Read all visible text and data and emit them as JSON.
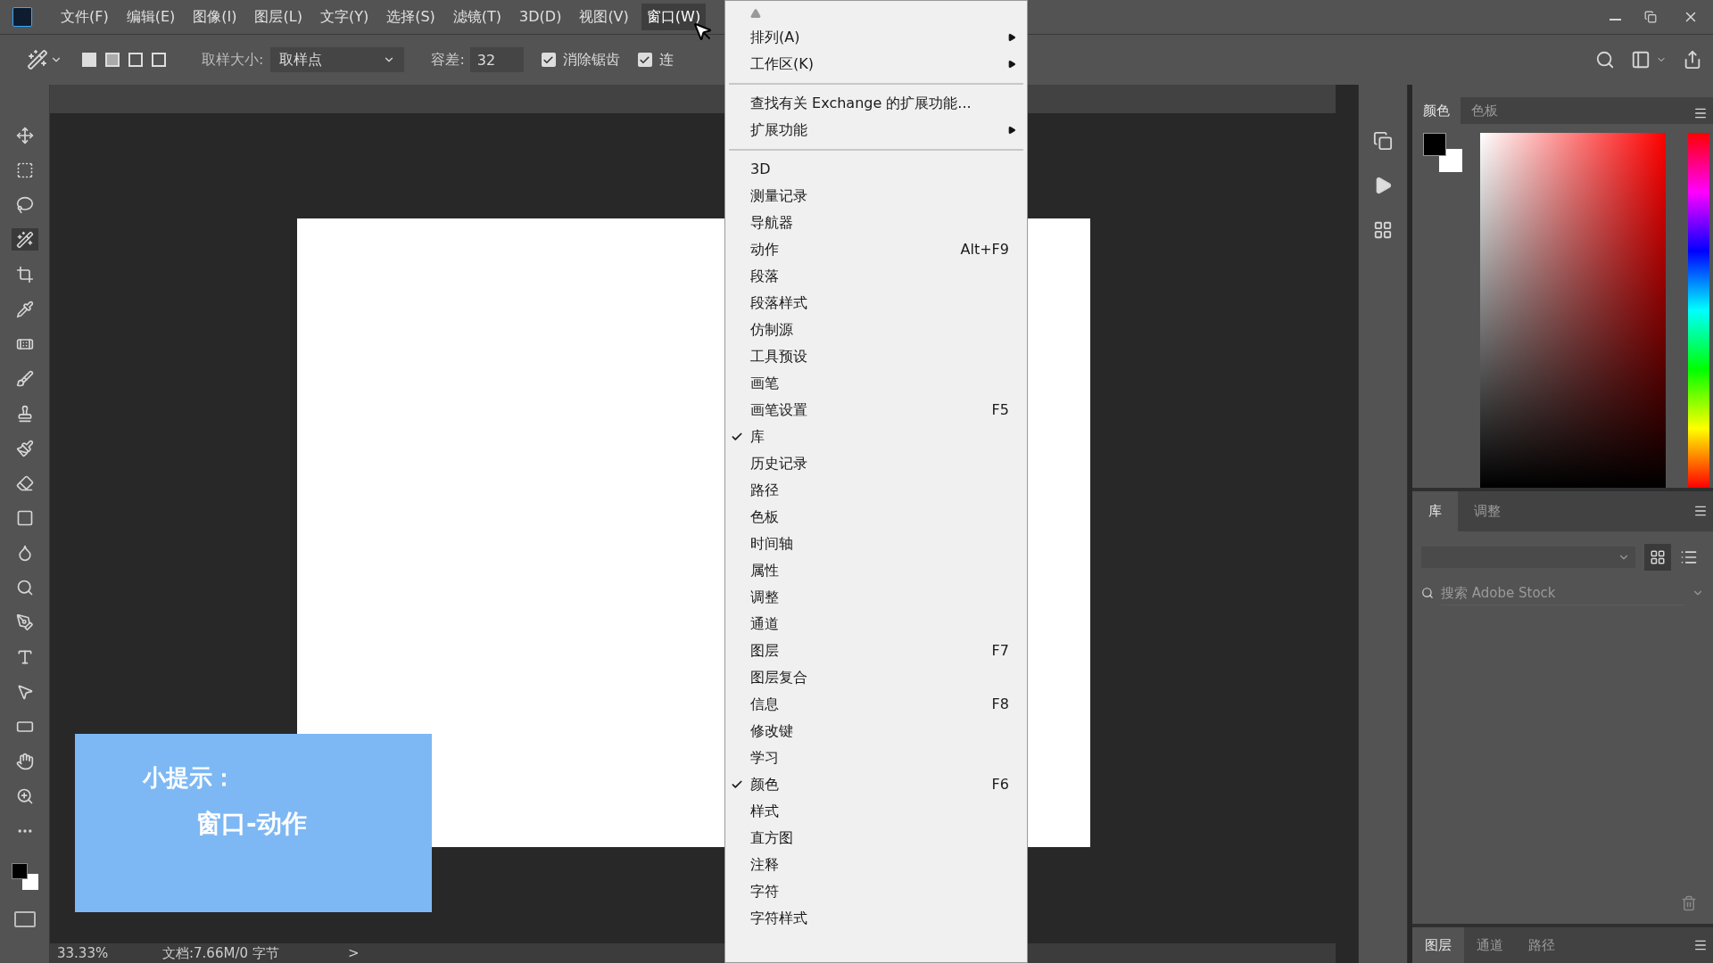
{
  "menu_bar": {
    "items": [
      {
        "label": "文件(F)",
        "selected": false
      },
      {
        "label": "编辑(E)",
        "selected": false
      },
      {
        "label": "图像(I)",
        "selected": false
      },
      {
        "label": "图层(L)",
        "selected": false
      },
      {
        "label": "文字(Y)",
        "selected": false
      },
      {
        "label": "选择(S)",
        "selected": false
      },
      {
        "label": "滤镜(T)",
        "selected": false
      },
      {
        "label": "3D(D)",
        "selected": false
      },
      {
        "label": "视图(V)",
        "selected": false
      },
      {
        "label": "窗口(W)",
        "selected": true
      }
    ]
  },
  "options_bar": {
    "sample_size_label": "取样大小:",
    "sample_size_value": "取样点",
    "tolerance_label": "容差:",
    "tolerance_value": "32",
    "checkboxes": [
      {
        "label": "消除锯齿",
        "checked": true
      },
      {
        "label": "连",
        "checked": true
      }
    ]
  },
  "tools": [
    {
      "selected": false
    },
    {
      "selected": false
    },
    {
      "selected": false
    },
    {
      "selected": true
    },
    {
      "selected": false
    },
    {
      "selected": false
    },
    {
      "selected": false
    },
    {
      "selected": false
    },
    {
      "selected": false
    },
    {
      "selected": false
    },
    {
      "selected": false
    },
    {
      "selected": false
    },
    {
      "selected": false
    },
    {
      "selected": false
    },
    {
      "selected": false
    },
    {
      "selected": false
    },
    {
      "selected": false
    },
    {
      "selected": false
    },
    {
      "selected": false
    },
    {
      "selected": false
    },
    {
      "selected": false
    }
  ],
  "tip": {
    "title": "小提示：",
    "body": "窗口-动作"
  },
  "window_menu": {
    "sections": [
      [
        {
          "label": "排列(A)",
          "submenu": true,
          "checked": false
        },
        {
          "label": "工作区(K)",
          "submenu": true,
          "checked": false
        }
      ],
      [
        {
          "label": "查找有关 Exchange 的扩展功能...",
          "submenu": false,
          "checked": false
        },
        {
          "label": "扩展功能",
          "submenu": true,
          "checked": false
        }
      ],
      [
        {
          "label": "3D",
          "submenu": false,
          "checked": false
        },
        {
          "label": "测量记录",
          "submenu": false,
          "checked": false
        },
        {
          "label": "导航器",
          "submenu": false,
          "checked": false
        },
        {
          "label": "动作",
          "shortcut": "Alt+F9",
          "submenu": false,
          "checked": false
        },
        {
          "label": "段落",
          "submenu": false,
          "checked": false
        },
        {
          "label": "段落样式",
          "submenu": false,
          "checked": false
        },
        {
          "label": "仿制源",
          "submenu": false,
          "checked": false
        },
        {
          "label": "工具预设",
          "submenu": false,
          "checked": false
        },
        {
          "label": "画笔",
          "submenu": false,
          "checked": false
        },
        {
          "label": "画笔设置",
          "shortcut": "F5",
          "submenu": false,
          "checked": false
        },
        {
          "label": "库",
          "submenu": false,
          "checked": true
        },
        {
          "label": "历史记录",
          "submenu": false,
          "checked": false
        },
        {
          "label": "路径",
          "submenu": false,
          "checked": false
        },
        {
          "label": "色板",
          "submenu": false,
          "checked": false
        },
        {
          "label": "时间轴",
          "submenu": false,
          "checked": false
        },
        {
          "label": "属性",
          "submenu": false,
          "checked": false
        },
        {
          "label": "调整",
          "submenu": false,
          "checked": false
        },
        {
          "label": "通道",
          "submenu": false,
          "checked": false
        },
        {
          "label": "图层",
          "shortcut": "F7",
          "submenu": false,
          "checked": false
        },
        {
          "label": "图层复合",
          "submenu": false,
          "checked": false
        },
        {
          "label": "信息",
          "shortcut": "F8",
          "submenu": false,
          "checked": false
        },
        {
          "label": "修改键",
          "submenu": false,
          "checked": false
        },
        {
          "label": "学习",
          "submenu": false,
          "checked": false
        },
        {
          "label": "颜色",
          "shortcut": "F6",
          "submenu": false,
          "checked": true
        },
        {
          "label": "样式",
          "submenu": false,
          "checked": false
        },
        {
          "label": "直方图",
          "submenu": false,
          "checked": false
        },
        {
          "label": "注释",
          "submenu": false,
          "checked": false
        },
        {
          "label": "字符",
          "submenu": false,
          "checked": false
        },
        {
          "label": "字符样式",
          "submenu": false,
          "checked": false
        }
      ]
    ]
  },
  "color_panel": {
    "tabs": [
      {
        "label": "颜色",
        "selected": true
      },
      {
        "label": "色板",
        "selected": false
      }
    ]
  },
  "library_panel": {
    "tabs": [
      {
        "label": "库",
        "selected": true
      },
      {
        "label": "调整",
        "selected": false
      }
    ],
    "search_placeholder": "搜索 Adobe Stock"
  },
  "layers_panel": {
    "tabs": [
      {
        "label": "图层",
        "selected": true
      },
      {
        "label": "通道",
        "selected": false
      },
      {
        "label": "路径",
        "selected": false
      }
    ]
  },
  "status_bar": {
    "zoom": "33.33%",
    "doc_info": "文档:7.66M/0 字节",
    "arrow": ">"
  }
}
